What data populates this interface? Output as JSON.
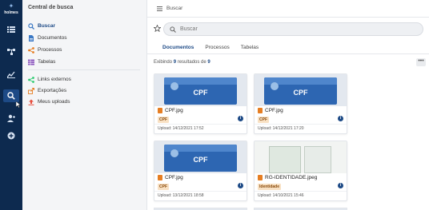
{
  "brand": {
    "name": "holmes"
  },
  "rail": {
    "items": [
      {
        "name": "list-icon"
      },
      {
        "name": "workflow-icon"
      },
      {
        "name": "chart-icon"
      },
      {
        "name": "search-icon",
        "active": true
      },
      {
        "name": "user-add-icon"
      },
      {
        "name": "plus-circle-icon"
      }
    ]
  },
  "subnav": {
    "title": "Central de busca",
    "group1": [
      {
        "label": "Buscar",
        "icon": "search-icon",
        "active": true
      },
      {
        "label": "Documentos",
        "icon": "document-icon"
      },
      {
        "label": "Processos",
        "icon": "share-icon"
      },
      {
        "label": "Tabelas",
        "icon": "table-icon"
      }
    ],
    "group2": [
      {
        "label": "Links externos",
        "icon": "link-icon"
      },
      {
        "label": "Exportações",
        "icon": "export-icon"
      },
      {
        "label": "Meus uploads",
        "icon": "upload-icon"
      }
    ]
  },
  "main": {
    "breadcrumb": "Buscar",
    "search_placeholder": "Buscar",
    "tabs": [
      {
        "label": "Documentos",
        "active": true
      },
      {
        "label": "Processos"
      },
      {
        "label": "Tabelas"
      }
    ],
    "results": {
      "prefix": "Exibindo",
      "shown": "9",
      "middle": "resultados de",
      "total": "9"
    },
    "more_label": "•••",
    "cards": [
      {
        "filename": "CPF.jpg",
        "tag": "CPF",
        "upload": "Upload: 14/12/2021 17:52",
        "thumb_text": "CPF",
        "type": "cpf"
      },
      {
        "filename": "CPF.jpg",
        "tag": "CPF",
        "upload": "Upload: 14/12/2021 17:20",
        "thumb_text": "CPF",
        "type": "cpf"
      },
      {
        "filename": "CPF.jpg",
        "tag": "CPF",
        "upload": "Upload: 13/12/2021 18:58",
        "thumb_text": "CPF",
        "type": "cpf"
      },
      {
        "filename": "RG-IDENTIDADE.jpeg",
        "tag": "Identidade",
        "upload": "Upload: 14/10/2021 15:46",
        "thumb_text": "",
        "type": "id"
      }
    ]
  }
}
